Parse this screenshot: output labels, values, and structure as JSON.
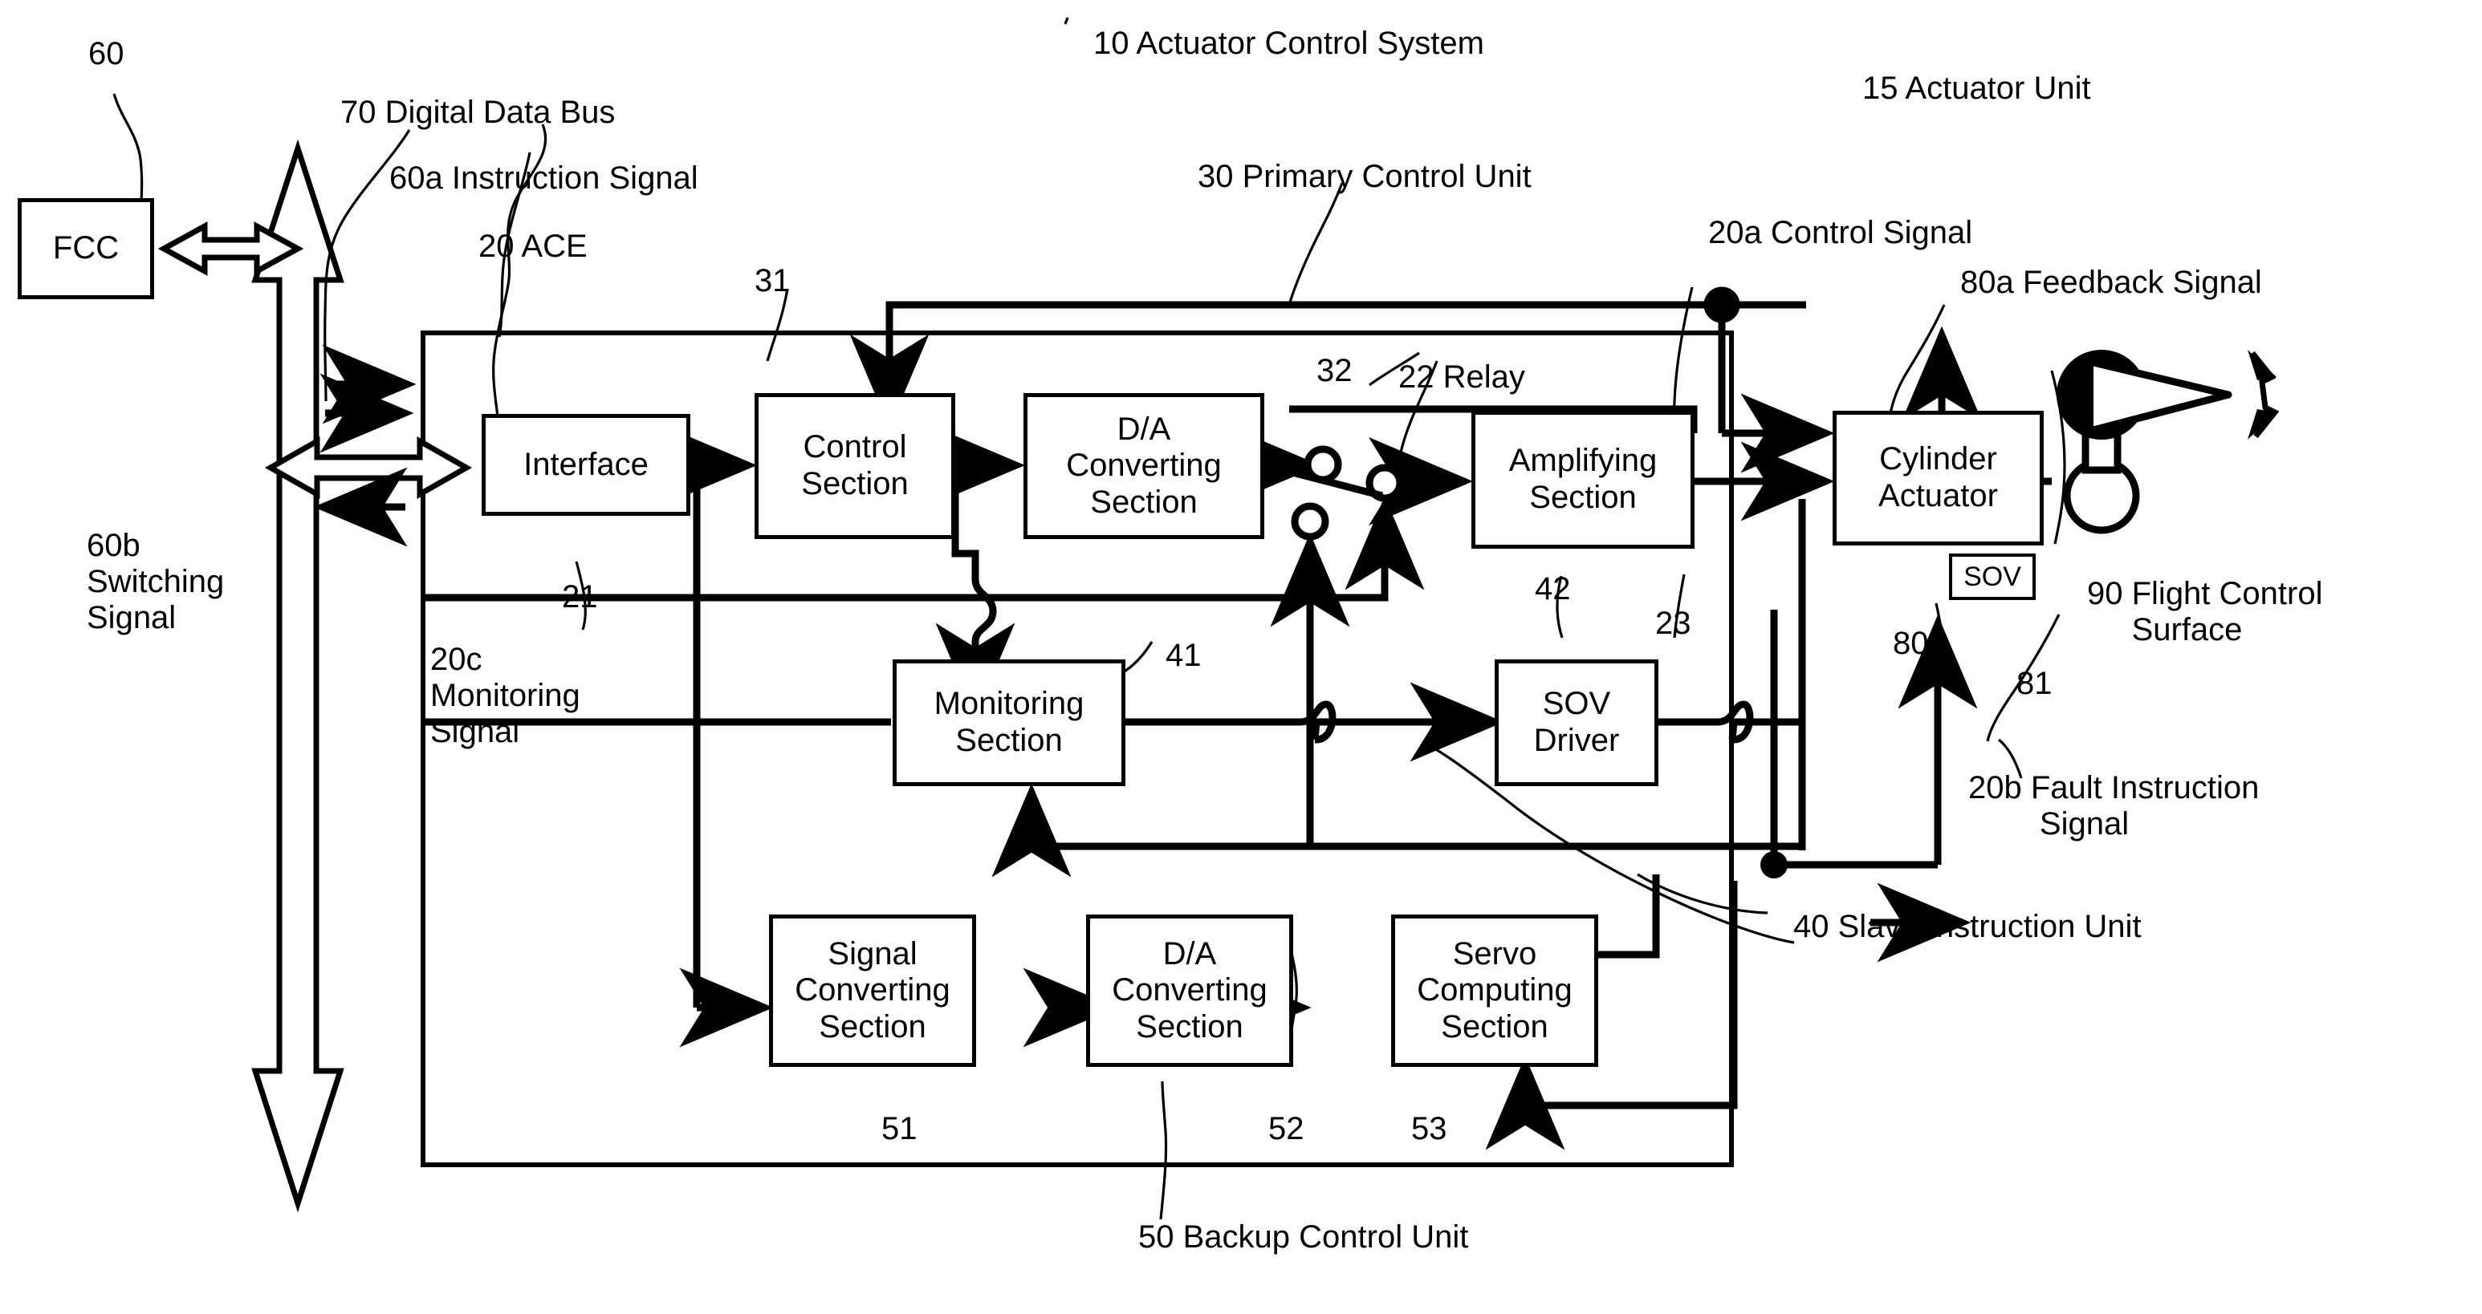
{
  "diagram": {
    "title_callout": "10 Actuator Control System",
    "blocks": {
      "fcc": "FCC",
      "interface": "Interface",
      "control_section": "Control\nSection",
      "da_converting_primary": "D/A\nConverting\nSection",
      "amplifying_section": "Amplifying\nSection",
      "cylinder_actuator": "Cylinder\nActuator",
      "sov": "SOV",
      "monitoring_section": "Monitoring\nSection",
      "sov_driver": "SOV\nDriver",
      "signal_converting_section": "Signal\nConverting\nSection",
      "da_converting_backup": "D/A\nConverting\nSection",
      "servo_computing_section": "Servo\nComputing\nSection"
    },
    "callouts": {
      "c60": "60",
      "c70": "70 Digital Data Bus",
      "c60a": "60a Instruction Signal",
      "c20": "20 ACE",
      "c31": "31",
      "c21": "21",
      "c10": "10 Actuator Control System",
      "c30": "30 Primary Control Unit",
      "c32": "32",
      "c22": "22 Relay",
      "c15": "15 Actuator Unit",
      "c20a": "20a Control Signal",
      "c80a": "80a Feedback Signal",
      "c42": "42",
      "c23": "23",
      "c80": "80",
      "c81": "81",
      "c90": "90 Flight Control\n     Surface",
      "c60b": "60b\nSwitching\nSignal",
      "c20c": "20c\nMonitoring\nSignal",
      "c41": "41",
      "c20b": "20b Fault Instruction\n        Signal",
      "c40": "40 Slave Instruction Unit",
      "c51": "51",
      "c52": "52",
      "c53": "53",
      "c50": "50 Backup Control Unit"
    },
    "colors": {
      "ink": "#000000",
      "paper": "#ffffff"
    }
  }
}
